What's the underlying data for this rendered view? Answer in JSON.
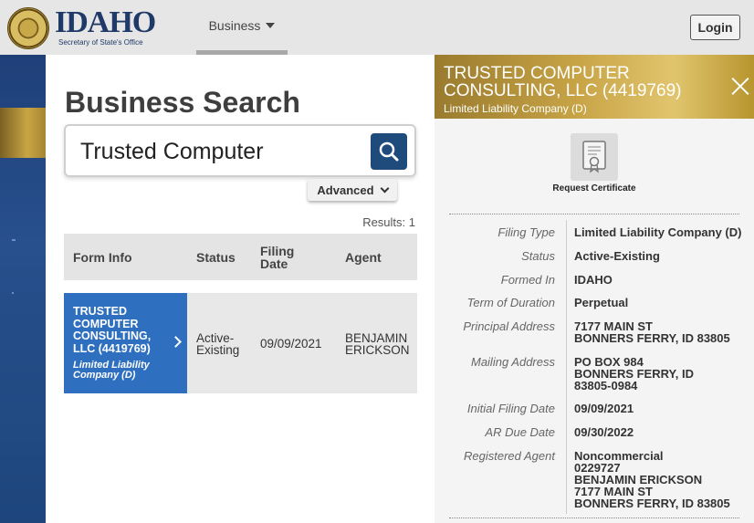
{
  "header": {
    "logo_text": "IDAHO",
    "logo_subtitle": "Secretary of State's Office",
    "nav_business": "Business",
    "login": "Login"
  },
  "search": {
    "title": "Business Search",
    "query": "Trusted Computer",
    "advanced": "Advanced",
    "results": "Results: 1"
  },
  "table": {
    "headers": [
      "Form Info",
      "Status",
      "Filing Date",
      "Agent"
    ],
    "rows": [
      {
        "name": "TRUSTED COMPUTER CONSULTING, LLC (4419769)",
        "type": "Limited Liability Company (D)",
        "status": "Active-Existing",
        "filing_date": "09/09/2021",
        "agent": "BENJAMIN ERICKSON"
      }
    ]
  },
  "detail": {
    "title": "TRUSTED COMPUTER CONSULTING, LLC (4419769)",
    "subtitle": "Limited Liability Company (D)",
    "request_certificate": "Request Certificate",
    "fields": [
      {
        "label": "Filing Type",
        "value": "Limited Liability Company (D)"
      },
      {
        "label": "Status",
        "value": "Active-Existing"
      },
      {
        "label": "Formed In",
        "value": "IDAHO"
      },
      {
        "label": "Term of Duration",
        "value": "Perpetual"
      },
      {
        "label": "Principal Address",
        "value": "7177 MAIN ST\nBONNERS FERRY, ID 83805"
      },
      {
        "label": "Mailing Address",
        "value": "PO BOX 984\nBONNERS FERRY, ID\n83805-0984"
      },
      {
        "label": "Initial Filing Date",
        "value": "09/09/2021"
      },
      {
        "label": "AR Due Date",
        "value": "09/30/2022"
      },
      {
        "label": "Registered Agent",
        "value": "Noncommercial\n0229727\nBENJAMIN  ERICKSON\n7177 MAIN ST\nBONNERS FERRY, ID  83805"
      }
    ]
  },
  "colors": {
    "brand_navy": "#1f3a68",
    "result_blue": "#2f6fc0",
    "gold": "#c8a446"
  }
}
